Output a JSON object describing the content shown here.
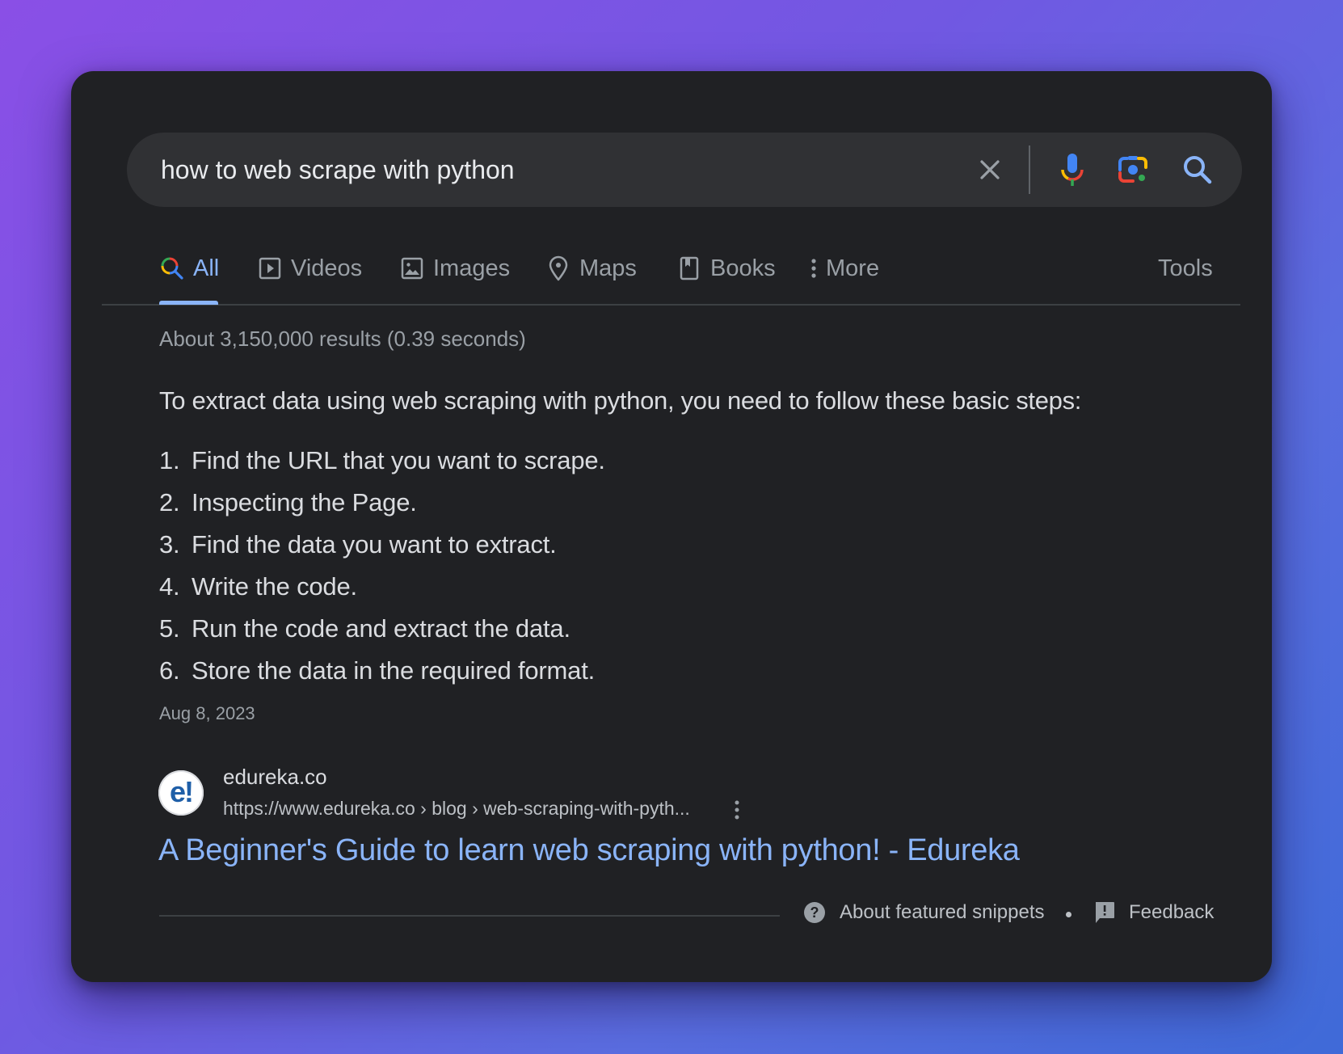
{
  "search": {
    "query": "how to web scrape with python",
    "clear_icon": "close-icon",
    "voice_icon": "microphone-icon",
    "lens_icon": "google-lens-icon",
    "search_icon": "search-icon"
  },
  "tabs": [
    {
      "label": "All",
      "icon": "search-icon",
      "active": true
    },
    {
      "label": "Videos",
      "icon": "play-icon",
      "active": false
    },
    {
      "label": "Images",
      "icon": "image-icon",
      "active": false
    },
    {
      "label": "Maps",
      "icon": "map-pin-icon",
      "active": false
    },
    {
      "label": "Books",
      "icon": "book-icon",
      "active": false
    },
    {
      "label": "More",
      "icon": "more-vertical-icon",
      "active": false
    }
  ],
  "tools_label": "Tools",
  "results_stats": "About 3,150,000 results (0.39 seconds)",
  "snippet": {
    "heading": "To extract data using web scraping with python, you need to follow these basic steps:",
    "steps": [
      {
        "num": "1.",
        "text": "Find the URL that you want to scrape."
      },
      {
        "num": "2.",
        "text": "Inspecting the Page."
      },
      {
        "num": "3.",
        "text": "Find the data you want to extract."
      },
      {
        "num": "4.",
        "text": "Write the code."
      },
      {
        "num": "5.",
        "text": "Run the code and extract the data."
      },
      {
        "num": "6.",
        "text": "Store the data in the required format."
      }
    ],
    "date": "Aug 8, 2023"
  },
  "source": {
    "favicon_text": "e!",
    "site_name": "edureka.co",
    "url": "https://www.edureka.co › blog › web-scraping-with-pyth...",
    "title": "A Beginner's Guide to learn web scraping with python! - Edureka"
  },
  "footer": {
    "about_label": "About featured snippets",
    "feedback_label": "Feedback"
  },
  "colors": {
    "card_bg": "#202124",
    "search_bg": "#303134",
    "link": "#8ab4f8",
    "text": "#dadce0",
    "muted": "#9aa0a6"
  }
}
